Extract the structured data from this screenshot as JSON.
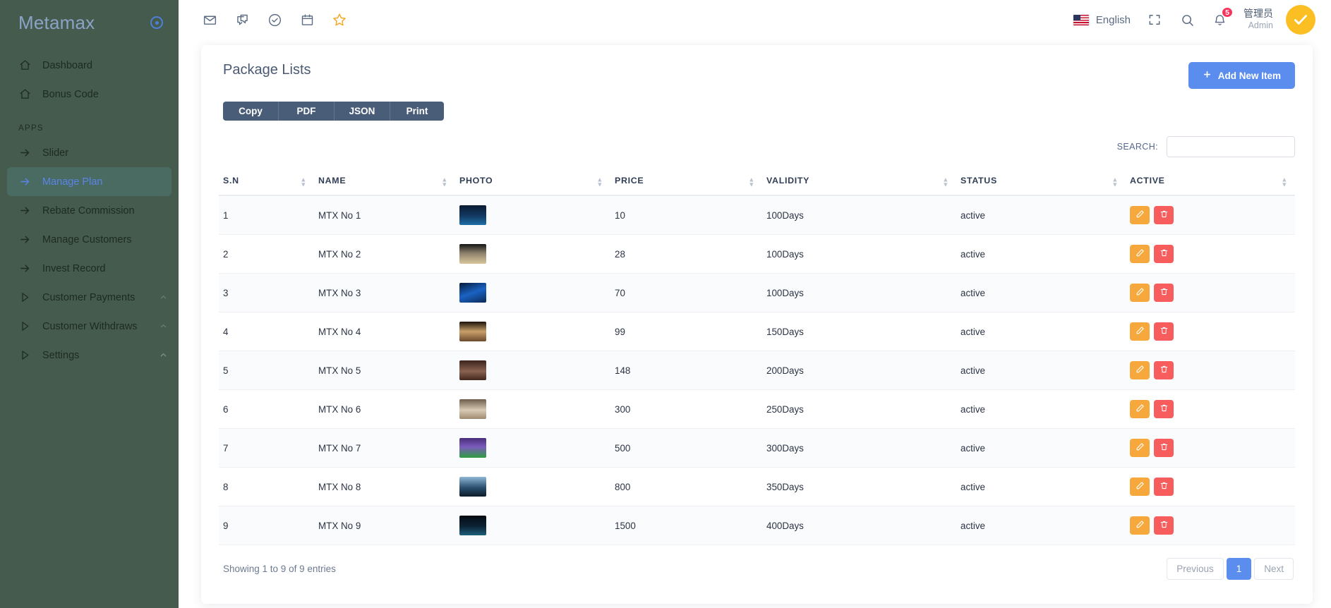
{
  "sidebar": {
    "brand": "Metamax",
    "brand_icon": "target-dot-icon",
    "top_items": [
      {
        "label": "Dashboard",
        "icon": "home-icon"
      },
      {
        "label": "Bonus Code",
        "icon": "home-icon"
      }
    ],
    "section_label": "APPS",
    "app_items": [
      {
        "label": "Slider",
        "icon": "arrow-right-icon",
        "active": false,
        "caret": ""
      },
      {
        "label": "Manage Plan",
        "icon": "arrow-right-icon",
        "active": true,
        "caret": ""
      },
      {
        "label": "Rebate Commission",
        "icon": "arrow-right-icon",
        "active": false,
        "caret": ""
      },
      {
        "label": "Manage Customers",
        "icon": "arrow-right-icon",
        "active": false,
        "caret": ""
      },
      {
        "label": "Invest Record",
        "icon": "arrow-right-icon",
        "active": false,
        "caret": ""
      },
      {
        "label": "Customer Payments",
        "icon": "play-triangle-icon",
        "active": false,
        "caret": "^"
      },
      {
        "label": "Customer Withdraws",
        "icon": "play-triangle-icon",
        "active": false,
        "caret": "^"
      },
      {
        "label": "Settings",
        "icon": "play-triangle-icon",
        "active": false,
        "caret": "^"
      }
    ]
  },
  "topbar": {
    "left_icons": [
      "mail-icon",
      "chat-icon",
      "check-circle-icon",
      "calendar-icon",
      "star-icon"
    ],
    "language": "English",
    "flag": "us-flag-icon",
    "fullscreen_icon": "fullscreen-icon",
    "search_icon": "search-icon",
    "bell_icon": "bell-icon",
    "notification_count": "5",
    "user_name": "管理员",
    "user_role": "Admin",
    "avatar_icon": "check-avatar-icon"
  },
  "page": {
    "title": "Package Lists",
    "add_button": "Add New Item",
    "add_button_icon": "plus-icon",
    "export_buttons": [
      "Copy",
      "PDF",
      "JSON",
      "Print"
    ],
    "search_label": "SEARCH:",
    "search_value": "",
    "search_placeholder": ""
  },
  "table": {
    "columns": [
      "S.N",
      "NAME",
      "PHOTO",
      "PRICE",
      "VALIDITY",
      "STATUS",
      "ACTIVE"
    ],
    "rows": [
      {
        "sn": "1",
        "name": "MTX No 1",
        "photo": "thumbnail-dark-blue-tech",
        "price": "10",
        "validity": "100Days",
        "status": "active"
      },
      {
        "sn": "2",
        "name": "MTX No 2",
        "photo": "thumbnail-building-sunset",
        "price": "28",
        "validity": "100Days",
        "status": "active"
      },
      {
        "sn": "3",
        "name": "MTX No 3",
        "photo": "thumbnail-blue-circuit",
        "price": "70",
        "validity": "100Days",
        "status": "active"
      },
      {
        "sn": "4",
        "name": "MTX No 4",
        "photo": "thumbnail-people-indoor",
        "price": "99",
        "validity": "150Days",
        "status": "active"
      },
      {
        "sn": "5",
        "name": "MTX No 5",
        "photo": "thumbnail-portrait",
        "price": "148",
        "validity": "200Days",
        "status": "active"
      },
      {
        "sn": "6",
        "name": "MTX No 6",
        "photo": "thumbnail-interior-beige",
        "price": "300",
        "validity": "250Days",
        "status": "active"
      },
      {
        "sn": "7",
        "name": "MTX No 7",
        "photo": "thumbnail-football-field",
        "price": "500",
        "validity": "300Days",
        "status": "active"
      },
      {
        "sn": "8",
        "name": "MTX No 8",
        "photo": "thumbnail-person-city",
        "price": "800",
        "validity": "350Days",
        "status": "active"
      },
      {
        "sn": "9",
        "name": "MTX No 9",
        "photo": "thumbnail-night-lights",
        "price": "1500",
        "validity": "400Days",
        "status": "active"
      }
    ],
    "row_actions": {
      "edit_icon": "pencil-icon",
      "delete_icon": "trash-icon"
    }
  },
  "footer": {
    "showing": "Showing 1 to 9 of 9 entries",
    "previous": "Previous",
    "current_page": "1",
    "next": "Next"
  },
  "colors": {
    "sidebar_bg": "#455b4d",
    "accent_blue": "#5b8def",
    "export_btn": "#4a5d78",
    "edit_btn": "#f7a83c",
    "delete_btn": "#f85d5d",
    "badge_red": "#f5365c",
    "avatar_yellow": "#fbbf24"
  }
}
